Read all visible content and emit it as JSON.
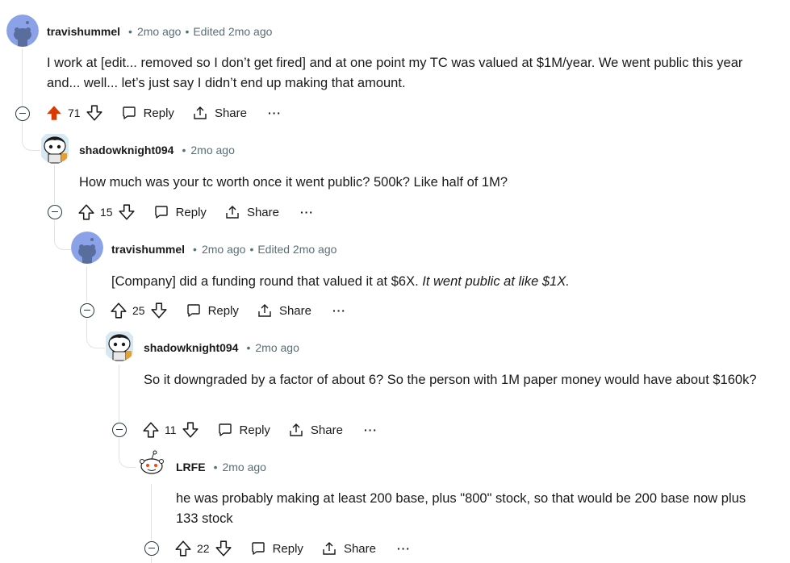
{
  "comments": [
    {
      "author": "travishummel",
      "time": "2mo ago",
      "edited": "Edited 2mo ago",
      "body": "I work at [edit... removed so I don’t get fired] and at one point my TC was valued at $1M/year. We went public this year and... well... let’s just say I didn’t end up making that amount.",
      "votes": "71",
      "upvoted": true,
      "avatar": "snoo-blue"
    },
    {
      "author": "shadowknight094",
      "time": "2mo ago",
      "body": "How much was your tc worth once it went public? 500k? Like half of 1M?",
      "votes": "15",
      "avatar": "snoo-custom"
    },
    {
      "author": "travishummel",
      "time": "2mo ago",
      "edited": "Edited 2mo ago",
      "body_plain": "[Company] did a funding round that valued it at $6X. ",
      "body_italic": "It went public at like $1X.",
      "votes": "25",
      "avatar": "snoo-blue"
    },
    {
      "author": "shadowknight094",
      "time": "2mo ago",
      "body": "So it downgraded by a factor of about 6? So the person with 1M paper money would have about $160k?",
      "votes": "11",
      "avatar": "snoo-custom"
    },
    {
      "author": "LRFE",
      "time": "2mo ago",
      "body": "he was probably making at least 200 base, plus \"800\" stock, so that would be 200 base now plus 133 stock",
      "votes": "22",
      "avatar": "snoo-default"
    }
  ],
  "actions": {
    "reply": "Reply",
    "share": "Share",
    "more": "···",
    "separator": "•"
  },
  "colors": {
    "upvote_active": "#d93a00",
    "meta": "#576f76",
    "thread_line": "#e0e3e5",
    "avatar_blue": "#8ba2e8"
  }
}
